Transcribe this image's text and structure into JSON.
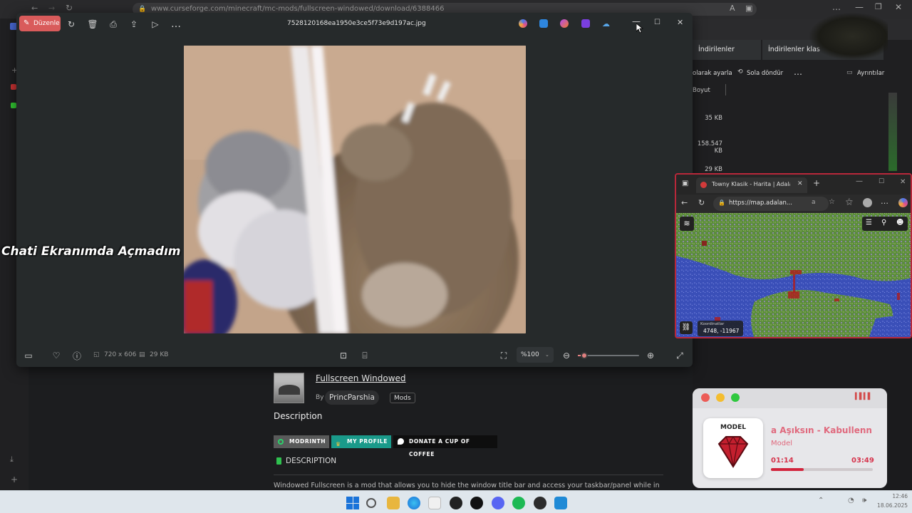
{
  "browser": {
    "url": "www.curseforge.com/minecraft/mc-mods/fullscreen-windowed/download/6388466"
  },
  "photos": {
    "edit_label": "Düzenle",
    "filename": "7528120168ea1950e3ce5f73e9d197ac.jpg",
    "dimensions": "720 x 606",
    "filesize": "29 KB",
    "zoom": "%100",
    "zoom_level": 0.1
  },
  "overlay_caption": "Chati Ekranımda Açmadım",
  "explorer": {
    "tab1": "İndirilenler",
    "tab2": "İndirilenler klas",
    "cmd_rotate_fragment": "olarak ayarla",
    "cmd_rotate_left": "Sola döndür",
    "cmd_details": "Ayrıntılar",
    "col_size": "Boyut",
    "sizes": [
      "35 KB",
      "158.547 KB",
      "29 KB"
    ]
  },
  "map": {
    "tab_title": "Towny Klasik - Harita | Adalance",
    "url": "https://map.adalan...",
    "coords_label": "Koordinatlar",
    "coords_value": "4748, -11967"
  },
  "mod": {
    "title": "Fullscreen Windowed",
    "by": "By",
    "author": "PrincParshia",
    "category": "Mods",
    "description_heading": "Description",
    "btn_modrinth": "MODRINTH",
    "btn_profile": "MY PROFILE",
    "btn_coffee": "DONATE A CUP OF COFFEE",
    "section_title": "DESCRIPTION",
    "snippet": "Windowed Fullscreen is a mod that allows you to hide the window title bar and access your taskbar/panel while in"
  },
  "music": {
    "cover_label": "MODEL",
    "song": "a Aşıksın - Kabullenn",
    "artist": "Model",
    "elapsed": "01:14",
    "total": "03:49",
    "progress": 0.32
  },
  "taskbar": {
    "time": "12:46",
    "date": "18.06.2025"
  }
}
